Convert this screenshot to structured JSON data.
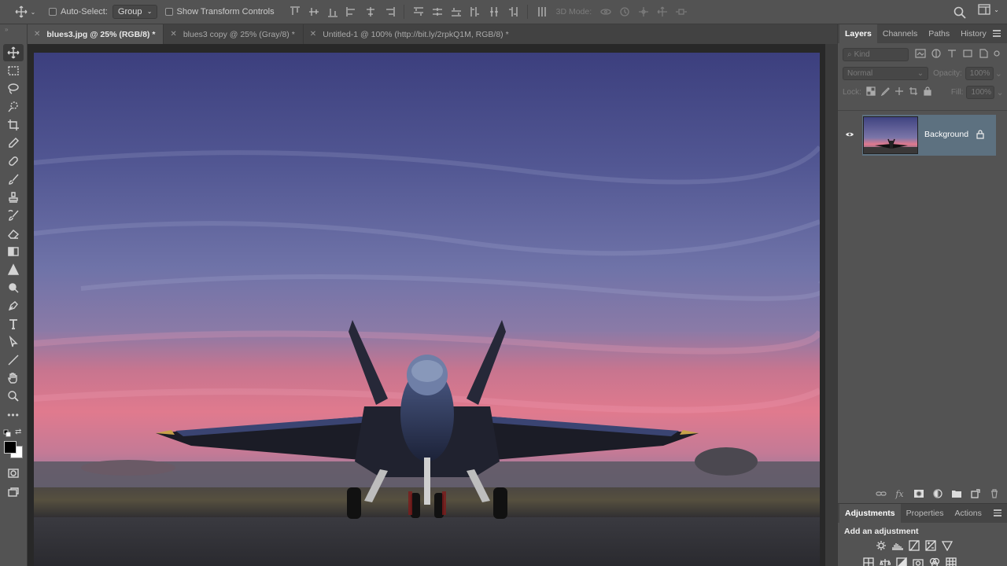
{
  "options_bar": {
    "auto_select_label": "Auto-Select:",
    "auto_select_value": "Group",
    "show_transform_label": "Show Transform Controls",
    "mode_3d_label": "3D Mode:"
  },
  "tabs": [
    {
      "label": "blues3.jpg @ 25% (RGB/8) *",
      "active": true
    },
    {
      "label": "blues3 copy @ 25% (Gray/8) *",
      "active": false
    },
    {
      "label": "Untitled-1 @ 100% (http://bit.ly/2rpkQ1M, RGB/8) *",
      "active": false
    }
  ],
  "layers_panel": {
    "tabs": [
      "Layers",
      "Channels",
      "Paths",
      "History"
    ],
    "kind_placeholder": "Kind",
    "blend_mode": "Normal",
    "opacity_label": "Opacity:",
    "opacity_value": "100%",
    "lock_label": "Lock:",
    "fill_label": "Fill:",
    "fill_value": "100%",
    "layer_name": "Background"
  },
  "adjustments_panel": {
    "tabs": [
      "Adjustments",
      "Properties",
      "Actions"
    ],
    "add_label": "Add an adjustment"
  },
  "colors": {
    "ui_bg": "#535353",
    "selection": "#5d7180",
    "canvas_bg": "#282828"
  },
  "icons": [
    "move-icon",
    "search-icon",
    "workspace-icon",
    "eye-icon",
    "lock-icon",
    "link-icon",
    "fx-icon",
    "mask-icon",
    "folder-icon",
    "new-layer-icon",
    "trash-icon"
  ]
}
